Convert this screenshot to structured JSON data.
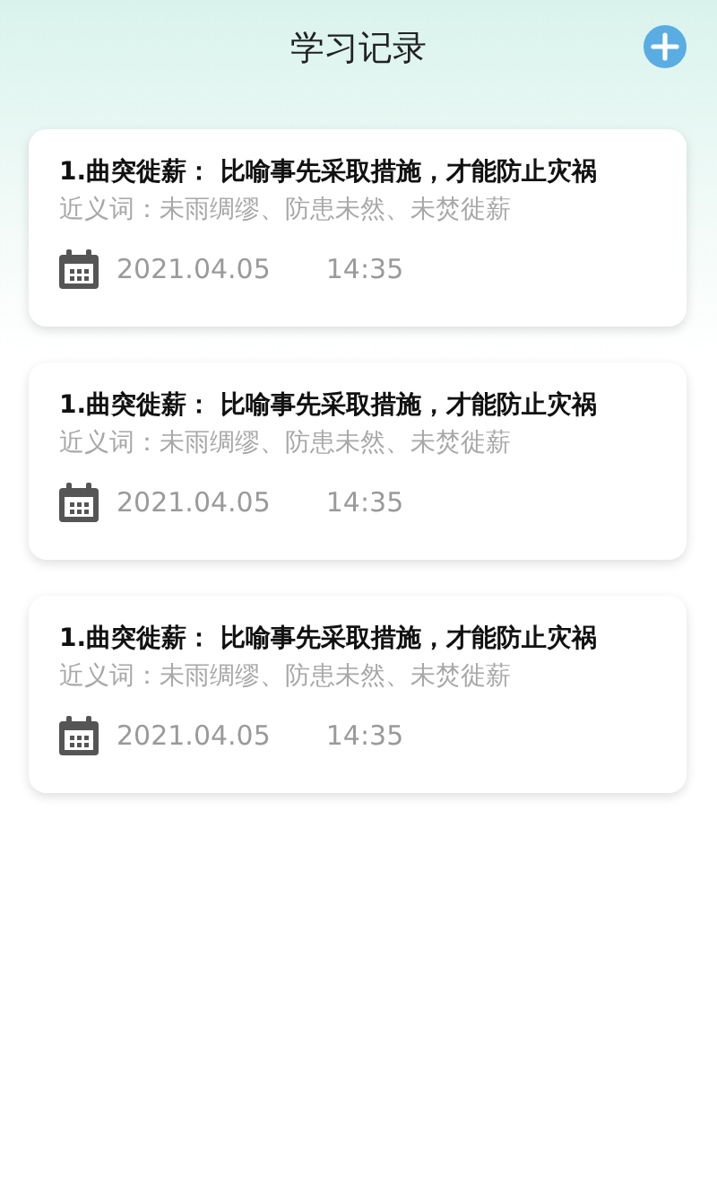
{
  "header": {
    "title": "学习记录"
  },
  "records": [
    {
      "title": "1.曲突徙薪： 比喻事先采取措施，才能防止灾祸",
      "synonyms": "近义词：未雨绸缪、防患未然、未焚徙薪",
      "date": "2021.04.05",
      "time": "14:35"
    },
    {
      "title": "1.曲突徙薪： 比喻事先采取措施，才能防止灾祸",
      "synonyms": "近义词：未雨绸缪、防患未然、未焚徙薪",
      "date": "2021.04.05",
      "time": "14:35"
    },
    {
      "title": "1.曲突徙薪： 比喻事先采取措施，才能防止灾祸",
      "synonyms": "近义词：未雨绸缪、防患未然、未焚徙薪",
      "date": "2021.04.05",
      "time": "14:35"
    }
  ]
}
